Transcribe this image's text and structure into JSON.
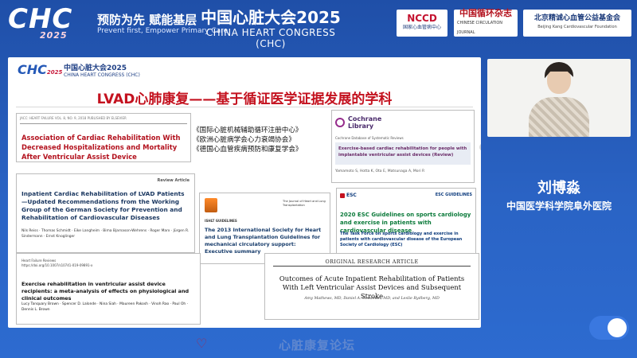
{
  "header": {
    "logo": "CHC",
    "logo_year": "2025",
    "slogan_cn": "预防为先 赋能基层",
    "slogan_en": "Prevent first, Empower Primary Care",
    "congress_cn": "中国心脏大会2025",
    "congress_en": "CHINA HEART CONGRESS (CHC)",
    "partners": {
      "nccd": "NCCD",
      "nccd_sub": "国家心血管病中心",
      "journal": "中国循环杂志",
      "journal_sub": "CHINESE CIRCULATION JOURNAL",
      "foundation": "北京精诚心血管公益基金会",
      "foundation_sub": "Beijing Kang Cardiovascular Foundation"
    }
  },
  "slide": {
    "logo": "CHC",
    "logo_year": "2025",
    "logo_cn": "中国心脏大会2025",
    "logo_en": "CHINA HEART CONGRESS (CHC)",
    "title": "LVAD心肺康复——基于循证医学证据发展的学科",
    "organizations": [
      "《国际心脏机械辅助循环注册中心》",
      "《欧洲心脏病学会心力衰竭协会》",
      "《德国心血管疾病预防和康复学会》"
    ],
    "card1": {
      "meta": "JACC: HEART FAILURE   VOL. 8, NO. 9, 2018   PUBLISHED BY ELSEVIER",
      "title": "Association of Cardiac Rehabilitation With Decreased Hospitalizations and Mortality After Ventricular Assist Device Implantation"
    },
    "cochrane": {
      "brand": "Cochrane",
      "brand2": "Library",
      "database": "Cochrane Database of Systematic Reviews",
      "title": "Exercise-based cardiac rehabilitation for people with implantable ventricular assist devices (Review)",
      "authors": "Yamamoto S, Hotta K, Ota E, Matsunaga A, Mori R"
    },
    "card2": {
      "tag": "Review Article",
      "title": "Inpatient Cardiac Rehabilitation of LVAD Patients—Updated Recommendations from the Working Group of the German Society for Prevention and Rehabilitation of Cardiovascular Diseases",
      "authors": "Nils Reiss · Thomas Schmidt · Eike Langheim · Bima Bjarnason-Wehrens · Roger Marx · Jürgen R. Sindermann · Ernst Knoglinger"
    },
    "card3": {
      "journal": "The Journal of Heart and Lung Transplantation",
      "label": "ISHLT GUIDELINES",
      "title": "The 2013 International Society for Heart and Lung Transplantation Guidelines for mechanical circulatory support: Executive summary"
    },
    "esc": {
      "logo": "ESC",
      "label": "ESC GUIDELINES",
      "title": "2020 ESC Guidelines on sports cardiology and exercise in patients with cardiovascular disease",
      "taskforce": "The Task Force on sports cardiology and exercise in patients with cardiovascular disease of the European Society of Cardiology (ESC)"
    },
    "card4": {
      "journal": "Heart Failure Reviews",
      "doi": "https://doi.org/10.1007/s10741-019-09891-x",
      "title": "Exercise rehabilitation in ventricular assist device recipients: a meta-analysis of effects on physiological and clinical outcomes",
      "authors": "Lucy Tanquary Brown · Spencer D. Lalonde · Nina Siah · Maureen Pakosh · Vinoh Rao · Paul Oh · Dennis L. Brown"
    },
    "card5": {
      "label": "ORIGINAL RESEARCH ARTICLE",
      "title": "Outcomes of Acute Inpatient Rehabilitation of Patients With Left Ventricular Assist Devices and Subsequent Stroke",
      "authors": "Amy Mathews, MD, Daniel A. Goodman, MD, and Leslie Rydberg, MD"
    }
  },
  "speaker": {
    "name": "刘博淼",
    "affiliation": "中国医学科学院阜外医院"
  },
  "footer": {
    "text": "心脏康复论坛"
  }
}
